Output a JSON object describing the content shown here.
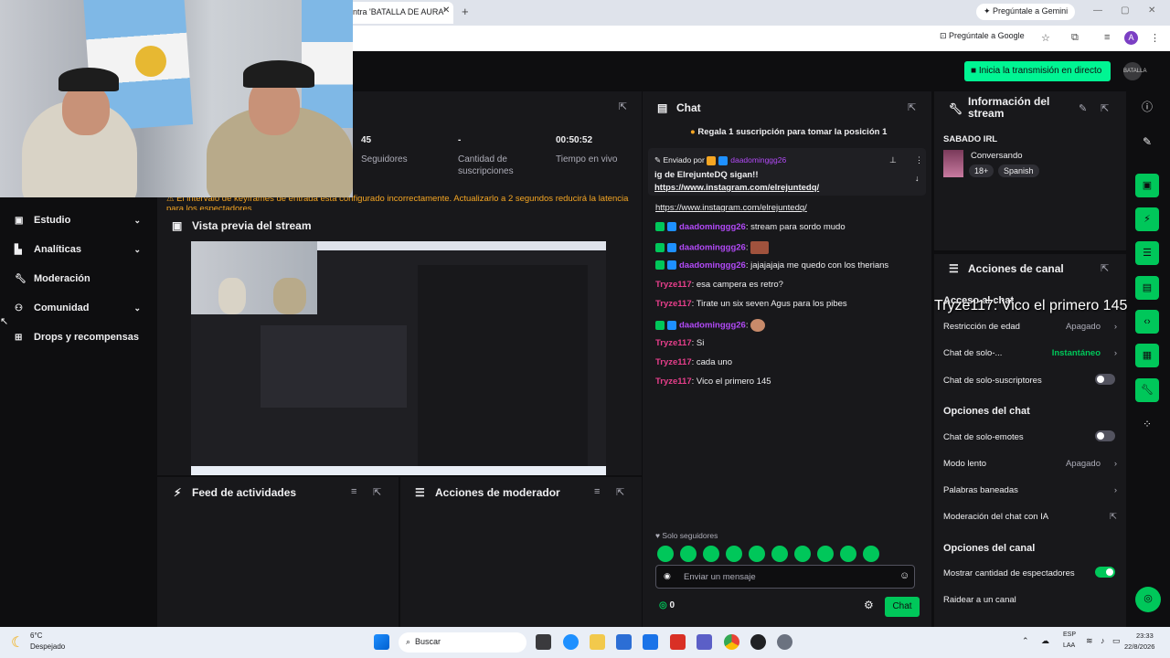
{
  "browser": {
    "tab_title": "ntra 'BATALLA DE AURA'",
    "gemini_label": "Pregúntale a Gemini",
    "google_search_label": "Pregúntale a Google",
    "profile_initial": "A"
  },
  "topnav": {
    "go_live_label": "Inicia la transmisión en directo",
    "avatar_text": "BATALLA"
  },
  "sidebar": {
    "items": [
      {
        "label": "Estudio",
        "icon": "camera-icon"
      },
      {
        "label": "Analíticas",
        "icon": "chart-icon"
      },
      {
        "label": "Moderación",
        "icon": "wrench-icon"
      },
      {
        "label": "Comunidad",
        "icon": "people-icon"
      },
      {
        "label": "Drops y recompensas",
        "icon": "gift-icon"
      }
    ]
  },
  "stats": {
    "followers_value": "45",
    "followers_label": "Seguidores",
    "subs_value": "-",
    "subs_label": "Cantidad de suscripciones",
    "uptime_value": "00:50:52",
    "uptime_label": "Tiempo en vivo"
  },
  "warning": "El intervalo de keyframes de entrada está configurado incorrectamente. Actualizarlo a 2 segundos reducirá la latencia para los espectadores.",
  "preview": {
    "title": "Vista previa del stream"
  },
  "activity_feed": {
    "title": "Feed de actividades"
  },
  "mod_actions": {
    "title": "Acciones de moderador"
  },
  "chat": {
    "title": "Chat",
    "gift_banner": "Regala 1 suscripción para tomar la posición 1",
    "pinned_prefix": "Enviado por",
    "pinned_user": "daadominggg26",
    "pinned_text": "ig de ElrejunteDQ sigan!!",
    "pinned_link": "https://www.instagram.com/elrejuntedq/",
    "link_line": "https://www.instagram.com/elrejuntedq/",
    "messages": [
      {
        "user": "daadominggg26",
        "text": ": stream para sordo mudo"
      },
      {
        "user": "daadominggg26",
        "text": ":"
      },
      {
        "user": "daadominggg26",
        "text": ": jajajajaja me quedo con los therians"
      },
      {
        "user": "Tryze117",
        "text": ": esa campera es retro?"
      },
      {
        "user": "Tryze117",
        "text": ": Tirate un six seven Agus para los pibes"
      },
      {
        "user": "daadominggg26",
        "text": ":"
      },
      {
        "user": "Tryze117",
        "text": ": Si"
      },
      {
        "user": "Tryze117",
        "text": ": cada uno"
      },
      {
        "user": "Tryze117",
        "text": ": Vico el primero 145"
      }
    ],
    "followers_only": "Solo seguidores",
    "input_placeholder": "Enviar un mensaje",
    "points": "0",
    "send_label": "Chat"
  },
  "stream_info": {
    "title": "Información del stream",
    "stream_title": "SABADO IRL",
    "category": "Conversando",
    "tags": [
      "18+",
      "Spanish"
    ]
  },
  "channel_actions": {
    "title": "Acciones de canal",
    "overlay_text": "Tryze117: Vico el primero 145",
    "access_header": "Acceso al chat",
    "age_restriction": "Restricción de edad",
    "age_value": "Apagado",
    "chat_only": "Chat de solo-...",
    "chat_only_value": "Instantáneo",
    "subs_only": "Chat de solo-suscriptores",
    "options_header": "Opciones del chat",
    "emotes_only": "Chat de solo-emotes",
    "slow_mode": "Modo lento",
    "slow_value": "Apagado",
    "banned_words": "Palabras baneadas",
    "ai_mod": "Moderación del chat con IA",
    "channel_header": "Opciones del canal",
    "show_viewers": "Mostrar cantidad de espectadores",
    "raid": "Raidear a un canal"
  },
  "taskbar": {
    "temperature": "6°C",
    "weather": "Despejado",
    "search": "Buscar",
    "lang1": "ESP",
    "lang2": "LAA",
    "time": "23:33",
    "date": "22/8/2026"
  },
  "colors": {
    "accent_green": "#00c75a",
    "go_live": "#00f593",
    "username_purple": "#b24af7",
    "username_pink": "#e83f8c",
    "warning": "#f5a623"
  }
}
